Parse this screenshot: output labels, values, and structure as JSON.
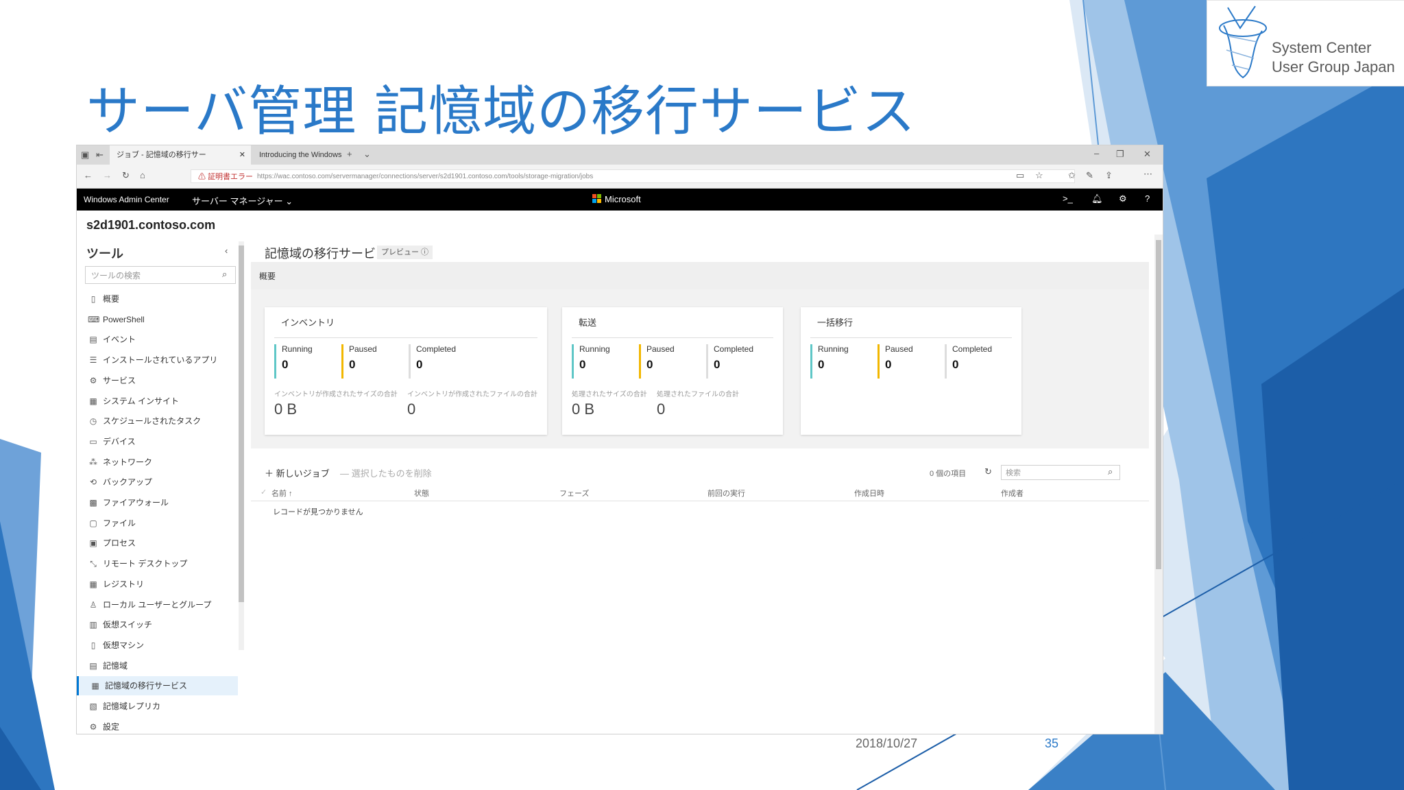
{
  "slide": {
    "title": "サーバ管理 記憶域の移行サービス",
    "date": "2018/10/27",
    "page": "35",
    "logo_line1": "System Center",
    "logo_line2": "User Group Japan"
  },
  "browser": {
    "tab1": "ジョブ - 記憶域の移行サー",
    "tab2": "Introducing the Windows S",
    "cert_warning": "証明書エラー",
    "url": "https://wac.contoso.com/servermanager/connections/server/s2d1901.contoso.com/tools/storage-migration/jobs"
  },
  "app": {
    "brand": "Windows Admin Center",
    "server_manager": "サーバー マネージャー",
    "microsoft": "Microsoft",
    "host": "s2d1901.contoso.com"
  },
  "sidebar": {
    "heading": "ツール",
    "search_placeholder": "ツールの検索",
    "items": [
      {
        "label": "概要",
        "icon": "▯"
      },
      {
        "label": "PowerShell",
        "icon": "⌨"
      },
      {
        "label": "イベント",
        "icon": "▤"
      },
      {
        "label": "インストールされているアプリ",
        "icon": "☰"
      },
      {
        "label": "サービス",
        "icon": "⚙"
      },
      {
        "label": "システム インサイト",
        "icon": "▦"
      },
      {
        "label": "スケジュールされたタスク",
        "icon": "◷"
      },
      {
        "label": "デバイス",
        "icon": "▭"
      },
      {
        "label": "ネットワーク",
        "icon": "⁂"
      },
      {
        "label": "バックアップ",
        "icon": "⟲"
      },
      {
        "label": "ファイアウォール",
        "icon": "▩"
      },
      {
        "label": "ファイル",
        "icon": "▢"
      },
      {
        "label": "プロセス",
        "icon": "▣"
      },
      {
        "label": "リモート デスクトップ",
        "icon": "⤡"
      },
      {
        "label": "レジストリ",
        "icon": "▦"
      },
      {
        "label": "ローカル ユーザーとグループ",
        "icon": "♙"
      },
      {
        "label": "仮想スイッチ",
        "icon": "▥"
      },
      {
        "label": "仮想マシン",
        "icon": "▯"
      },
      {
        "label": "記憶域",
        "icon": "▤"
      },
      {
        "label": "記憶域の移行サービス",
        "icon": "▦"
      },
      {
        "label": "記憶域レプリカ",
        "icon": "▧"
      },
      {
        "label": "設定",
        "icon": "⚙"
      }
    ]
  },
  "main": {
    "title": "記憶域の移行サービス",
    "preview": "プレビュー ⓘ",
    "overview": "概要",
    "cards": [
      {
        "title": "インベントリ",
        "running_label": "Running",
        "running": "0",
        "paused_label": "Paused",
        "paused": "0",
        "completed_label": "Completed",
        "completed": "0",
        "sub1_label": "インベントリが作成されたサイズの合計",
        "sub1_value": "0 B",
        "sub2_label": "インベントリが作成されたファイルの合計",
        "sub2_value": "0"
      },
      {
        "title": "転送",
        "running_label": "Running",
        "running": "0",
        "paused_label": "Paused",
        "paused": "0",
        "completed_label": "Completed",
        "completed": "0",
        "sub1_label": "処理されたサイズの合計",
        "sub1_value": "0 B",
        "sub2_label": "処理されたファイルの合計",
        "sub2_value": "0"
      },
      {
        "title": "一括移行",
        "running_label": "Running",
        "running": "0",
        "paused_label": "Paused",
        "paused": "0",
        "completed_label": "Completed",
        "completed": "0"
      }
    ],
    "new_job": "新しいジョブ",
    "delete_selected": "選択したものを削除",
    "item_count": "0 個の項目",
    "search_placeholder": "検索",
    "columns": [
      "名前 ↑",
      "状態",
      "フェーズ",
      "前回の実行",
      "作成日時",
      "作成者"
    ],
    "empty_message": "レコードが見つかりません"
  },
  "colors": {
    "accent": "#2a79c8",
    "running": "#5fc7c7",
    "paused": "#f2b700",
    "completed": "#dddddd"
  }
}
